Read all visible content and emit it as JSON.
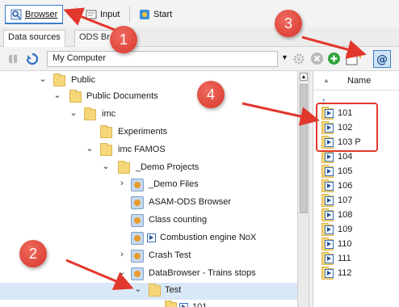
{
  "tabs": [
    {
      "label": "Browser",
      "icon": "browser-icon",
      "active": true
    },
    {
      "label": "Input",
      "icon": "input-icon",
      "active": false
    },
    {
      "label": "Start",
      "icon": "start-icon",
      "active": false
    }
  ],
  "subtabs": [
    {
      "label": "Data sources",
      "active": true
    },
    {
      "label": "ODS Brow",
      "active": false
    }
  ],
  "toolbar": {
    "location": "My Computer",
    "buttons": [
      "back-icon",
      "refresh-icon",
      "settings-icon",
      "stop-icon",
      "add-icon",
      "new-item-icon",
      "at-sign-icon"
    ]
  },
  "tree": [
    {
      "label": "Public",
      "depth": 0,
      "expanded": true,
      "icon": "folder-icon"
    },
    {
      "label": "Public Documents",
      "depth": 1,
      "expanded": true,
      "icon": "folder-icon"
    },
    {
      "label": "imc",
      "depth": 2,
      "expanded": true,
      "icon": "folder-icon"
    },
    {
      "label": "Experiments",
      "depth": 3,
      "expanded": null,
      "icon": "folder-icon"
    },
    {
      "label": "imc FAMOS",
      "depth": 3,
      "expanded": true,
      "icon": "folder-icon"
    },
    {
      "label": "_Demo Projects",
      "depth": 4,
      "expanded": true,
      "icon": "folder-icon"
    },
    {
      "label": "_Demo Files",
      "depth": 5,
      "expanded": false,
      "icon": "database-icon"
    },
    {
      "label": "ASAM-ODS Browser",
      "depth": 5,
      "expanded": null,
      "icon": "database-icon"
    },
    {
      "label": "Class counting",
      "depth": 5,
      "expanded": null,
      "icon": "database-icon"
    },
    {
      "label": "Combustion engine NoX",
      "depth": 5,
      "expanded": null,
      "icon": "database-channel-icon"
    },
    {
      "label": "Crash Test",
      "depth": 5,
      "expanded": false,
      "icon": "database-icon"
    },
    {
      "label": "DataBrowser - Trains stops",
      "depth": 5,
      "expanded": true,
      "icon": "database-icon"
    },
    {
      "label": "Test",
      "depth": 6,
      "expanded": true,
      "icon": "folder-icon",
      "selected": true
    },
    {
      "label": "101",
      "depth": 7,
      "expanded": null,
      "icon": "folder-channel-icon"
    }
  ],
  "list": {
    "header": "Name",
    "items": [
      "101",
      "102",
      "103 P",
      "104",
      "105",
      "106",
      "107",
      "108",
      "109",
      "110",
      "111",
      "112"
    ]
  },
  "callouts": [
    "1",
    "2",
    "3",
    "4"
  ],
  "colors": {
    "accent": "#3b7fd0",
    "callout": "#d6362b",
    "folder": "#f5d77a",
    "selection": "#d9e8f7"
  }
}
